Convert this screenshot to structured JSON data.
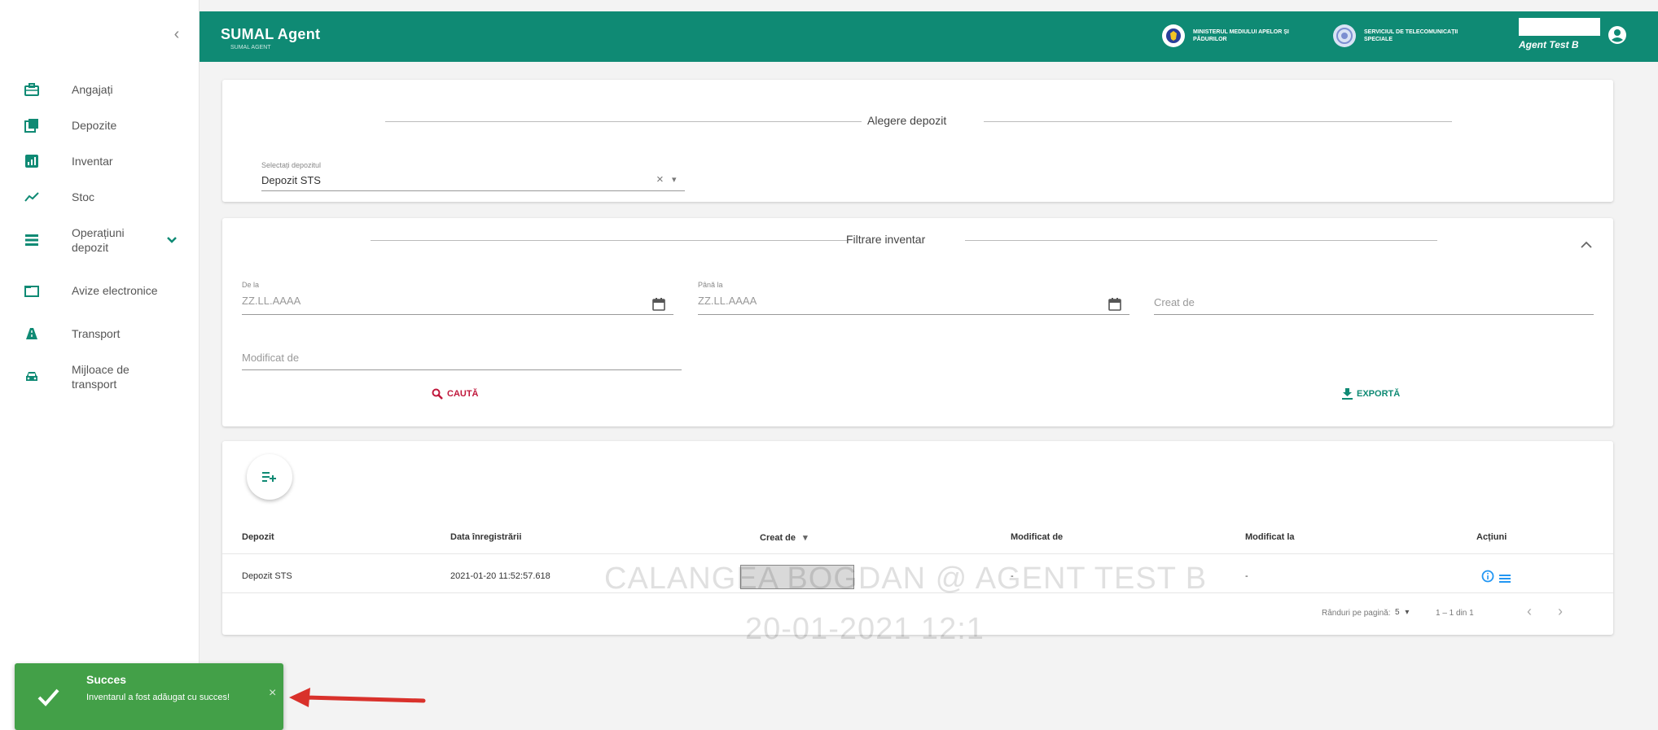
{
  "colors": {
    "brand": "#0f8a74",
    "accent_red": "#c0183c",
    "success": "#43a048",
    "info_blue": "#2196f3"
  },
  "sidebar": {
    "collapse_icon": "chevron-left-icon",
    "items": [
      {
        "label": "Angajați",
        "icon": "briefcase-icon"
      },
      {
        "label": "Depozite",
        "icon": "copy-icon"
      },
      {
        "label": "Inventar",
        "icon": "inventory-icon"
      },
      {
        "label": "Stoc",
        "icon": "trend-icon"
      },
      {
        "label": "Operațiuni depozit",
        "icon": "list-icon",
        "expandable": true
      },
      {
        "label": "Avize electronice",
        "icon": "folder-icon"
      },
      {
        "label": "Transport",
        "icon": "road-icon"
      },
      {
        "label": "Mijloace de transport",
        "icon": "car-icon"
      }
    ]
  },
  "header": {
    "title": "SUMAL Agent",
    "subtitle": "SUMAL AGENT",
    "logo1_text": "MINISTERUL MEDIULUI APELOR ȘI PĂDURILOR",
    "logo2_text": "SERVICIUL DE TELECOMUNICAȚII SPECIALE",
    "user_name": "Agent Test B"
  },
  "deposit_card": {
    "title": "Alegere depozit",
    "select_label": "Selectați depozitul",
    "select_value": "Depozit STS",
    "clear_glyph": "×",
    "dropdown_glyph": "▾"
  },
  "filter_card": {
    "title": "Filtrare inventar",
    "from_label": "De la",
    "from_placeholder": "ZZ.LL.AAAA",
    "to_label": "Până la",
    "to_placeholder": "ZZ.LL.AAAA",
    "created_by_placeholder": "Creat de",
    "modified_by_placeholder": "Modificat de",
    "search_label": "CAUTĂ",
    "export_label": "EXPORTĂ"
  },
  "table": {
    "columns": [
      "Depozit",
      "Data înregistrării",
      "Creat de",
      "Modificat de",
      "Modificat la",
      "Acțiuni"
    ],
    "sort_indicator": "▾",
    "rows": [
      {
        "depozit": "Depozit STS",
        "data": "2021-01-20 11:52:57.618",
        "creat_de": "",
        "modificat_de": "-",
        "modificat_la": "-"
      }
    ],
    "rows_per_page_label": "Rânduri pe pagină:",
    "rows_per_page_value": "5",
    "range_label": "1 – 1 din 1",
    "prev_glyph": "‹",
    "next_glyph": "›"
  },
  "watermark": {
    "line1": "CALANGEA BOGDAN @ AGENT TEST B",
    "line2": "20-01-2021 12:1"
  },
  "toast": {
    "title": "Succes",
    "message": "Inventarul a fost adăugat cu succes!",
    "close_glyph": "×"
  }
}
